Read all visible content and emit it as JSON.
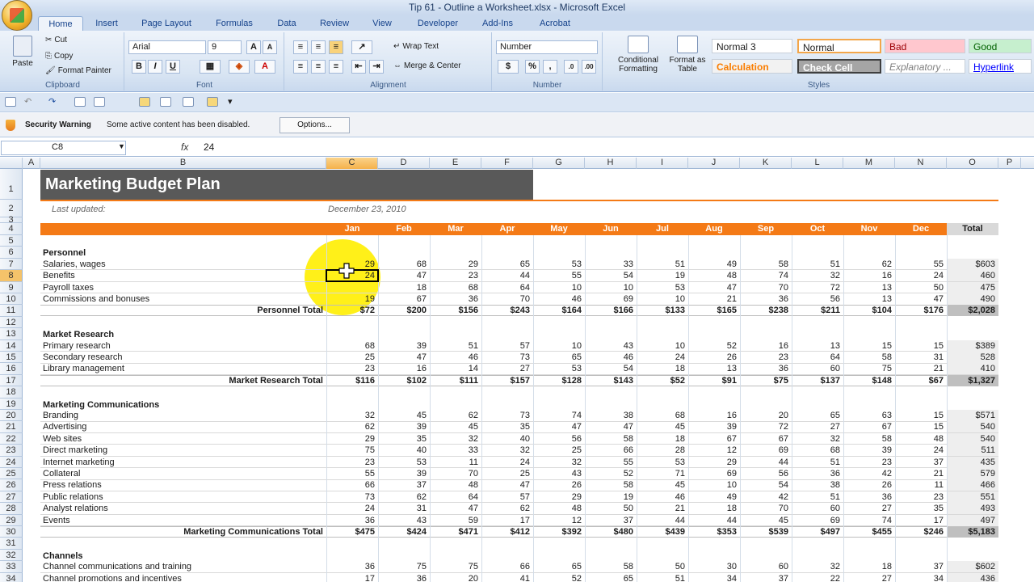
{
  "window": {
    "title": "Tip 61 - Outline a Worksheet.xlsx - Microsoft Excel"
  },
  "tabs": [
    "Home",
    "Insert",
    "Page Layout",
    "Formulas",
    "Data",
    "Review",
    "View",
    "Developer",
    "Add-Ins",
    "Acrobat"
  ],
  "ribbon": {
    "clipboard": {
      "paste": "Paste",
      "cut": "Cut",
      "copy": "Copy",
      "format_painter": "Format Painter",
      "label": "Clipboard"
    },
    "font": {
      "name": "Arial",
      "size": "9",
      "label": "Font",
      "bold": "B",
      "italic": "I",
      "underline": "U"
    },
    "alignment": {
      "wrap": "Wrap Text",
      "merge": "Merge & Center",
      "label": "Alignment"
    },
    "number": {
      "format": "Number",
      "label": "Number",
      "currency": "$",
      "percent": "%",
      "comma": ","
    },
    "styles": {
      "cond": "Conditional Formatting",
      "fmt_table": "Format as Table",
      "label": "Styles",
      "cells": [
        {
          "name": "Normal 3"
        },
        {
          "name": "Normal"
        },
        {
          "name": "Bad"
        },
        {
          "name": "Good"
        },
        {
          "name": "Calculation"
        },
        {
          "name": "Check Cell"
        },
        {
          "name": "Explanatory ..."
        },
        {
          "name": "Hyperlink"
        }
      ]
    }
  },
  "security": {
    "label": "Security Warning",
    "message": "Some active content has been disabled.",
    "options": "Options..."
  },
  "formula_bar": {
    "cell": "C8",
    "fx": "fx",
    "value": "24"
  },
  "columns": [
    "A",
    "B",
    "C",
    "D",
    "E",
    "F",
    "G",
    "H",
    "I",
    "J",
    "K",
    "L",
    "M",
    "N",
    "O",
    "P"
  ],
  "sheet": {
    "title": "Marketing Budget Plan",
    "last_updated_label": "Last updated:",
    "last_updated": "December 23, 2010",
    "months": [
      "Jan",
      "Feb",
      "Mar",
      "Apr",
      "May",
      "Jun",
      "Jul",
      "Aug",
      "Sep",
      "Oct",
      "Nov",
      "Dec"
    ],
    "total_label": "Total",
    "rows": [
      {
        "r": "5"
      },
      {
        "r": "6",
        "kind": "section",
        "label": "Personnel"
      },
      {
        "r": "7",
        "label": "Salaries, wages",
        "vals": [
          "29",
          "68",
          "29",
          "65",
          "53",
          "33",
          "51",
          "49",
          "58",
          "51",
          "62",
          "55"
        ],
        "total": "$603"
      },
      {
        "r": "8",
        "label": "Benefits",
        "vals": [
          "24",
          "47",
          "23",
          "44",
          "55",
          "54",
          "19",
          "48",
          "74",
          "32",
          "16",
          "24"
        ],
        "total": "460"
      },
      {
        "r": "9",
        "label": "Payroll taxes",
        "vals": [
          "",
          "18",
          "68",
          "64",
          "10",
          "10",
          "53",
          "47",
          "70",
          "72",
          "13",
          "50"
        ],
        "total": "475"
      },
      {
        "r": "10",
        "label": "Commissions and bonuses",
        "vals": [
          "19",
          "67",
          "36",
          "70",
          "46",
          "69",
          "10",
          "21",
          "36",
          "56",
          "13",
          "47"
        ],
        "total": "490"
      },
      {
        "r": "11",
        "kind": "total",
        "label": "Personnel Total",
        "vals": [
          "$72",
          "$200",
          "$156",
          "$243",
          "$164",
          "$166",
          "$133",
          "$165",
          "$238",
          "$211",
          "$104",
          "$176"
        ],
        "total": "$2,028"
      },
      {
        "r": "12"
      },
      {
        "r": "13",
        "kind": "section",
        "label": "Market Research"
      },
      {
        "r": "14",
        "label": "Primary research",
        "vals": [
          "68",
          "39",
          "51",
          "57",
          "10",
          "43",
          "10",
          "52",
          "16",
          "13",
          "15",
          "15"
        ],
        "total": "$389"
      },
      {
        "r": "15",
        "label": "Secondary research",
        "vals": [
          "25",
          "47",
          "46",
          "73",
          "65",
          "46",
          "24",
          "26",
          "23",
          "64",
          "58",
          "31"
        ],
        "total": "528"
      },
      {
        "r": "16",
        "label": "Library management",
        "vals": [
          "23",
          "16",
          "14",
          "27",
          "53",
          "54",
          "18",
          "13",
          "36",
          "60",
          "75",
          "21"
        ],
        "total": "410"
      },
      {
        "r": "17",
        "kind": "total",
        "label": "Market Research Total",
        "vals": [
          "$116",
          "$102",
          "$111",
          "$157",
          "$128",
          "$143",
          "$52",
          "$91",
          "$75",
          "$137",
          "$148",
          "$67"
        ],
        "total": "$1,327"
      },
      {
        "r": "18"
      },
      {
        "r": "19",
        "kind": "section",
        "label": "Marketing Communications"
      },
      {
        "r": "20",
        "label": "Branding",
        "vals": [
          "32",
          "45",
          "62",
          "73",
          "74",
          "38",
          "68",
          "16",
          "20",
          "65",
          "63",
          "15"
        ],
        "total": "$571"
      },
      {
        "r": "21",
        "label": "Advertising",
        "vals": [
          "62",
          "39",
          "45",
          "35",
          "47",
          "47",
          "45",
          "39",
          "72",
          "27",
          "67",
          "15"
        ],
        "total": "540"
      },
      {
        "r": "22",
        "label": "Web sites",
        "vals": [
          "29",
          "35",
          "32",
          "40",
          "56",
          "58",
          "18",
          "67",
          "67",
          "32",
          "58",
          "48"
        ],
        "total": "540"
      },
      {
        "r": "23",
        "label": "Direct marketing",
        "vals": [
          "75",
          "40",
          "33",
          "32",
          "25",
          "66",
          "28",
          "12",
          "69",
          "68",
          "39",
          "24"
        ],
        "total": "511"
      },
      {
        "r": "24",
        "label": "Internet marketing",
        "vals": [
          "23",
          "53",
          "11",
          "24",
          "32",
          "55",
          "53",
          "29",
          "44",
          "51",
          "23",
          "37"
        ],
        "total": "435"
      },
      {
        "r": "25",
        "label": "Collateral",
        "vals": [
          "55",
          "39",
          "70",
          "25",
          "43",
          "52",
          "71",
          "69",
          "56",
          "36",
          "42",
          "21"
        ],
        "total": "579"
      },
      {
        "r": "26",
        "label": "Press relations",
        "vals": [
          "66",
          "37",
          "48",
          "47",
          "26",
          "58",
          "45",
          "10",
          "54",
          "38",
          "26",
          "11"
        ],
        "total": "466"
      },
      {
        "r": "27",
        "label": "Public relations",
        "vals": [
          "73",
          "62",
          "64",
          "57",
          "29",
          "19",
          "46",
          "49",
          "42",
          "51",
          "36",
          "23"
        ],
        "total": "551"
      },
      {
        "r": "28",
        "label": "Analyst relations",
        "vals": [
          "24",
          "31",
          "47",
          "62",
          "48",
          "50",
          "21",
          "18",
          "70",
          "60",
          "27",
          "35"
        ],
        "total": "493"
      },
      {
        "r": "29",
        "label": "Events",
        "vals": [
          "36",
          "43",
          "59",
          "17",
          "12",
          "37",
          "44",
          "44",
          "45",
          "69",
          "74",
          "17"
        ],
        "total": "497"
      },
      {
        "r": "30",
        "kind": "total",
        "label": "Marketing Communications Total",
        "vals": [
          "$475",
          "$424",
          "$471",
          "$412",
          "$392",
          "$480",
          "$439",
          "$353",
          "$539",
          "$497",
          "$455",
          "$246"
        ],
        "total": "$5,183"
      },
      {
        "r": "31"
      },
      {
        "r": "32",
        "kind": "section",
        "label": "Channels"
      },
      {
        "r": "33",
        "label": "Channel communications and training",
        "vals": [
          "36",
          "75",
          "75",
          "66",
          "65",
          "58",
          "50",
          "30",
          "60",
          "32",
          "18",
          "37"
        ],
        "total": "$602"
      },
      {
        "r": "34",
        "label": "Channel promotions and incentives",
        "vals": [
          "17",
          "36",
          "20",
          "41",
          "52",
          "65",
          "51",
          "34",
          "37",
          "22",
          "27",
          "34"
        ],
        "total": "436"
      }
    ]
  }
}
